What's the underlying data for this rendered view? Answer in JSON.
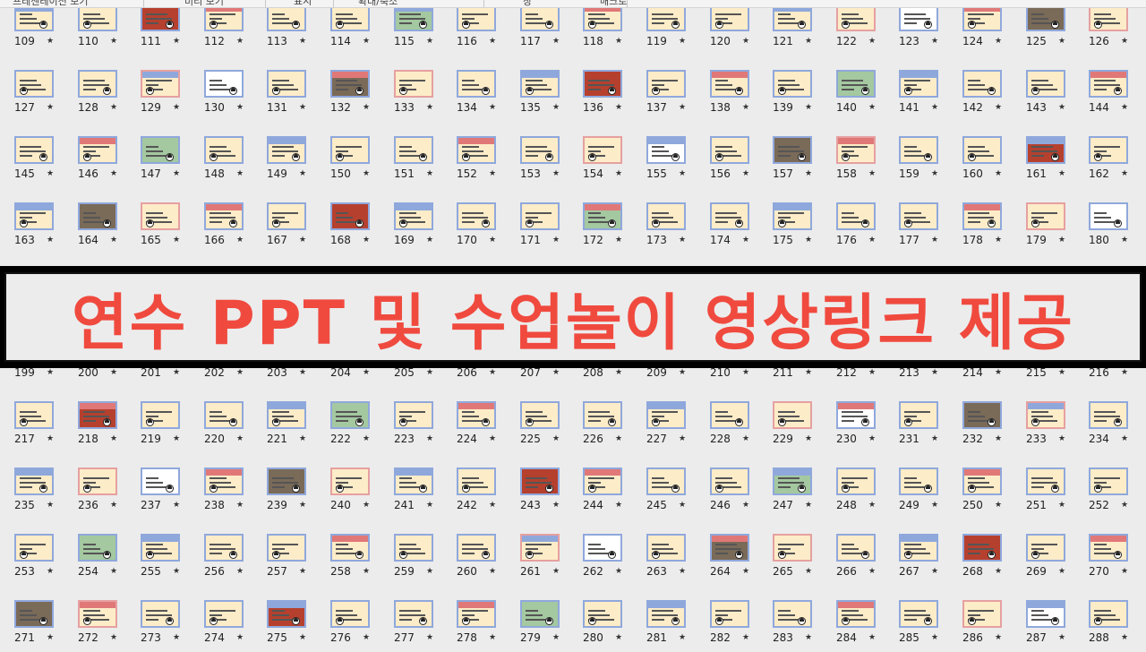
{
  "toolbar": {
    "labels": [
      "프레젠테이션 보기",
      "미리 보기",
      "표시",
      "확대/축소",
      "창",
      "매크로"
    ]
  },
  "banner": {
    "text": "연수 PPT 및 수업놀이 영상링크 제공"
  },
  "slides": {
    "rows": [
      {
        "numbers": [
          "109",
          "110",
          "111",
          "112",
          "113",
          "114",
          "115",
          "116",
          "117",
          "118",
          "119",
          "120",
          "121",
          "122",
          "123",
          "124",
          "125",
          "126"
        ]
      },
      {
        "numbers": [
          "127",
          "128",
          "129",
          "130",
          "131",
          "132",
          "133",
          "134",
          "135",
          "136",
          "137",
          "138",
          "139",
          "140",
          "141",
          "142",
          "143",
          "144"
        ]
      },
      {
        "numbers": [
          "145",
          "146",
          "147",
          "148",
          "149",
          "150",
          "151",
          "152",
          "153",
          "154",
          "155",
          "156",
          "157",
          "158",
          "159",
          "160",
          "161",
          "162"
        ]
      },
      {
        "numbers": [
          "163",
          "164",
          "165",
          "166",
          "167",
          "168",
          "169",
          "170",
          "171",
          "172",
          "173",
          "174",
          "175",
          "176",
          "177",
          "178",
          "179",
          "180"
        ]
      },
      {
        "numbers": [
          "199",
          "200",
          "201",
          "202",
          "203",
          "204",
          "205",
          "206",
          "207",
          "208",
          "209",
          "210",
          "211",
          "212",
          "213",
          "214",
          "215",
          "216"
        ]
      },
      {
        "numbers": [
          "217",
          "218",
          "219",
          "220",
          "221",
          "222",
          "223",
          "224",
          "225",
          "226",
          "227",
          "228",
          "229",
          "230",
          "231",
          "232",
          "233",
          "234"
        ]
      },
      {
        "numbers": [
          "235",
          "236",
          "237",
          "238",
          "239",
          "240",
          "241",
          "242",
          "243",
          "244",
          "245",
          "246",
          "247",
          "248",
          "249",
          "250",
          "251",
          "252"
        ]
      },
      {
        "numbers": [
          "253",
          "254",
          "255",
          "256",
          "257",
          "258",
          "259",
          "260",
          "261",
          "262",
          "263",
          "264",
          "265",
          "266",
          "267",
          "268",
          "269",
          "270"
        ]
      },
      {
        "numbers": [
          "271",
          "272",
          "273",
          "274",
          "275",
          "276",
          "277",
          "278",
          "279",
          "280",
          "281",
          "282",
          "283",
          "284",
          "285",
          "286",
          "287",
          "288"
        ]
      }
    ],
    "star_glyph": "★"
  },
  "colors": {
    "banner_text": "#f04a3f",
    "thumb_fill": "#fdecc8",
    "thumb_border": "#8fa8dc",
    "background": "#ececec"
  }
}
